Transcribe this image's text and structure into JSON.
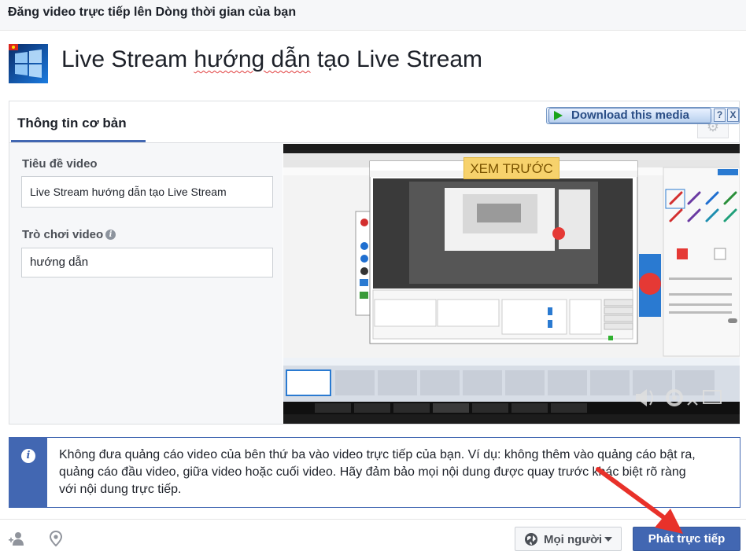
{
  "header": {
    "title": "Đăng video trực tiếp lên Dòng thời gian của bạn"
  },
  "stream": {
    "title_part1": "Live Stream ",
    "title_part2": "hướng dẫn",
    "title_part3": " tạo Live Stream"
  },
  "tabs": [
    {
      "label": "Thông tin cơ bản",
      "active": true
    }
  ],
  "form": {
    "title_label": "Tiêu đề video",
    "title_value": "Live Stream hướng dẫn tạo Live Stream",
    "game_label": "Trò chơi video",
    "game_value": "hướng dẫn",
    "info_glyph": "i"
  },
  "download_overlay": {
    "label": "Download this media",
    "help": "?",
    "close": "X"
  },
  "preview": {
    "badge": "XEM TRƯỚC"
  },
  "notice": {
    "icon": "i",
    "text": "Không đưa quảng cáo video của bên thứ ba vào video trực tiếp của bạn. Ví dụ: không thêm vào quảng cáo bật ra, quảng cáo đầu video, giữa video hoặc cuối video. Hãy đảm bảo mọi nội dung được quay trước khác biệt rõ ràng với nội dung trực tiếp."
  },
  "footer": {
    "audience_label": "Mọi người",
    "go_live_label": "Phát trực tiếp"
  },
  "icons": [
    "tag-people-icon",
    "location-pin-icon",
    "globe-icon",
    "chevron-down-icon",
    "info-icon",
    "gear-icon",
    "play-icon"
  ],
  "colors": {
    "accent": "#4267b2",
    "preview_badge": "#f7d26c",
    "annotation_arrow": "#e8312a"
  }
}
